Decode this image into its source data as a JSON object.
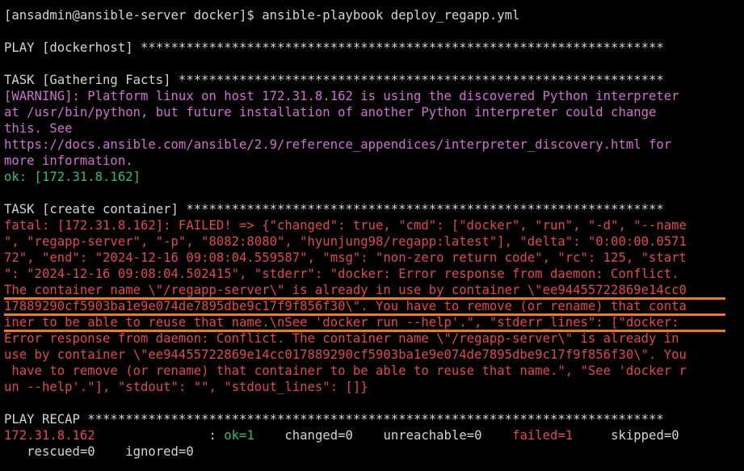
{
  "terminal": {
    "prompt": "[ansadmin@ansible-server docker]$ ansible-playbook deploy_regapp.yml",
    "play_header": "PLAY [dockerhost] *********************************************************************",
    "gather_header": "TASK [Gathering Facts] ****************************************************************",
    "warning": [
      "[WARNING]: Platform linux on host 172.31.8.162 is using the discovered Python interpreter",
      "at /usr/bin/python, but future installation of another Python interpreter could change",
      "this. See",
      "https://docs.ansible.com/ansible/2.9/reference_appendices/interpreter_discovery.html for",
      "more information."
    ],
    "ok_line": "ok: [172.31.8.162]",
    "create_header": "TASK [create container] ***************************************************************",
    "fatal": [
      "fatal: [172.31.8.162]: FAILED! => {\"changed\": true, \"cmd\": [\"docker\", \"run\", \"-d\", \"--name",
      "\", \"regapp-server\", \"-p\", \"8082:8080\", \"hyunjung98/regapp:latest\"], \"delta\": \"0:00:00.0571",
      "72\", \"end\": \"2024-12-16 09:08:04.559587\", \"msg\": \"non-zero return code\", \"rc\": 125, \"start",
      "\": \"2024-12-16 09:08:04.502415\", \"stderr\": \"docker: Error response from daemon: Conflict.",
      "The container name \\\"/regapp-server\\\" is already in use by container \\\"ee94455722869e14cc0",
      "17889290cf5903ba1e9e074de7895dbe9c17f9f856f30\\\". You have to remove (or rename) that conta",
      "iner to be able to reuse that name.\\nSee 'docker run --help'.\", \"stderr_lines\": [\"docker:",
      "Error response from daemon: Conflict. The container name \\\"/regapp-server\\\" is already in",
      "use by container \\\"ee94455722869e14cc017889290cf5903ba1e9e074de7895dbe9c17f9f856f30\\\". You",
      " have to remove (or rename) that container to be able to reuse that name.\", \"See 'docker r",
      "un --help'.\"], \"stdout\": \"\", \"stdout_lines\": []}"
    ],
    "recap_header": "PLAY RECAP ****************************************************************************",
    "recap": {
      "host": "172.31.8.162",
      "sep": "               : ",
      "ok": "ok=1",
      "changed": "    changed=0    ",
      "unreachable": "unreachable=0    ",
      "failed": "failed=1",
      "skipped": "     skipped=0",
      "line2": "   rescued=0    ignored=0"
    }
  },
  "colors": {
    "background": "#000000",
    "text": "#d4d4d4",
    "warning": "#d16fd0",
    "ok": "#2fbf71",
    "error": "#e0484b",
    "annotation_underline": "#f07a1a"
  }
}
